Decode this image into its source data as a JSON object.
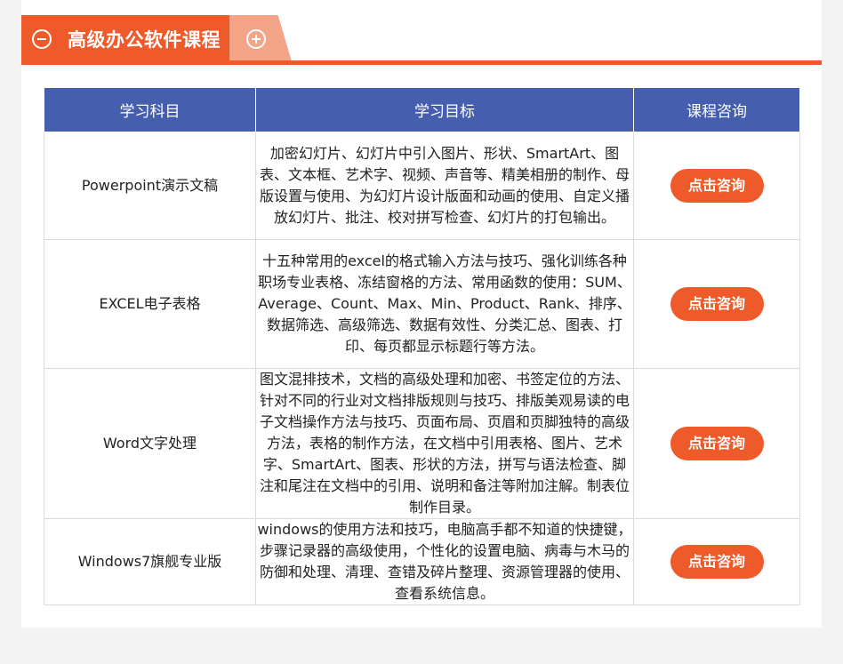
{
  "section": {
    "title": "高级办公软件课程",
    "collapse_icon": "minus-circle-icon",
    "expand_icon": "plus-circle-icon",
    "accent_color": "#ef5a2b",
    "header_color": "#455fae"
  },
  "table": {
    "headers": [
      "学习科目",
      "学习目标",
      "课程咨询"
    ],
    "rows": [
      {
        "subject": "Powerpoint演示文稿",
        "goal": "加密幻灯片、幻灯片中引入图片、形状、SmartArt、图表、文本框、艺术字、视频、声音等、精美相册的制作、母版设置与使用、为幻灯片设计版面和动画的使用、自定义播放幻灯片、批注、校对拼写检查、幻灯片的打包输出。",
        "button": "点击咨询"
      },
      {
        "subject": "EXCEL电子表格",
        "goal": "十五种常用的excel的格式输入方法与技巧、强化训练各种职场专业表格、冻结窗格的方法、常用函数的使用：SUM、Average、Count、Max、Min、Product、Rank、排序、数据筛选、高级筛选、数据有效性、分类汇总、图表、打印、每页都显示标题行等方法。",
        "button": "点击咨询"
      },
      {
        "subject": "Word文字处理",
        "goal": "图文混排技术，文档的高级处理和加密、书签定位的方法、针对不同的行业对文档排版规则与技巧、排版美观易读的电子文档操作方法与技巧、页面布局、页眉和页脚独特的高级方法，表格的制作方法，在文档中引用表格、图片、艺术字、SmartArt、图表、形状的方法，拼写与语法检查、脚注和尾注在文档中的引用、说明和备注等附加注解。制表位制作目录。",
        "button": "点击咨询"
      },
      {
        "subject": "Windows7旗舰专业版",
        "goal": "windows的使用方法和技巧，电脑高手都不知道的快捷键，步骤记录器的高级使用，个性化的设置电脑、病毒与木马的防御和处理、清理、查错及碎片整理、资源管理器的使用、查看系统信息。",
        "button": "点击咨询"
      }
    ]
  }
}
